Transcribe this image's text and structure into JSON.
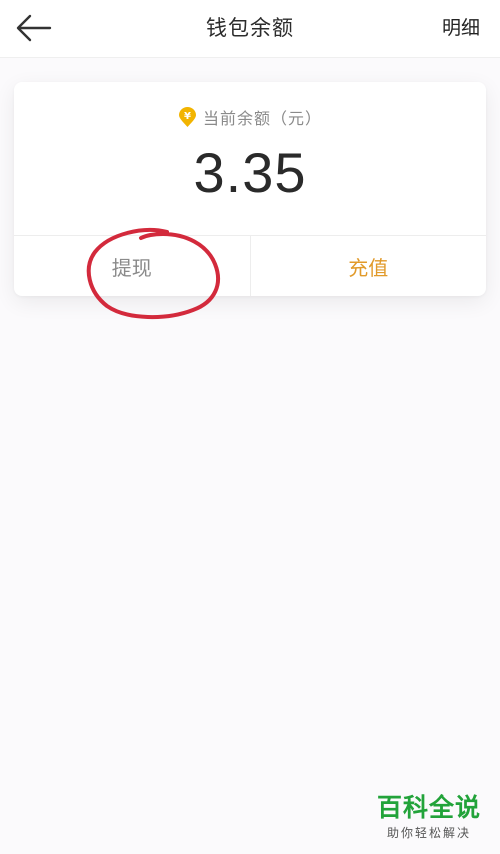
{
  "header": {
    "back_icon": "arrow-left-icon",
    "title": "钱包余额",
    "right_label": "明细"
  },
  "card": {
    "coin_icon": "yuan-coin-icon",
    "balance_label": "当前余额（元）",
    "balance_amount": "3.35",
    "withdraw_label": "提现",
    "recharge_label": "充值"
  },
  "colors": {
    "accent": "#e19a2a",
    "coin": "#f2b400",
    "annotation": "#d32a3c",
    "watermark": "#22a33a"
  },
  "watermark": {
    "title": "百科全说",
    "subtitle": "助你轻松解决"
  }
}
